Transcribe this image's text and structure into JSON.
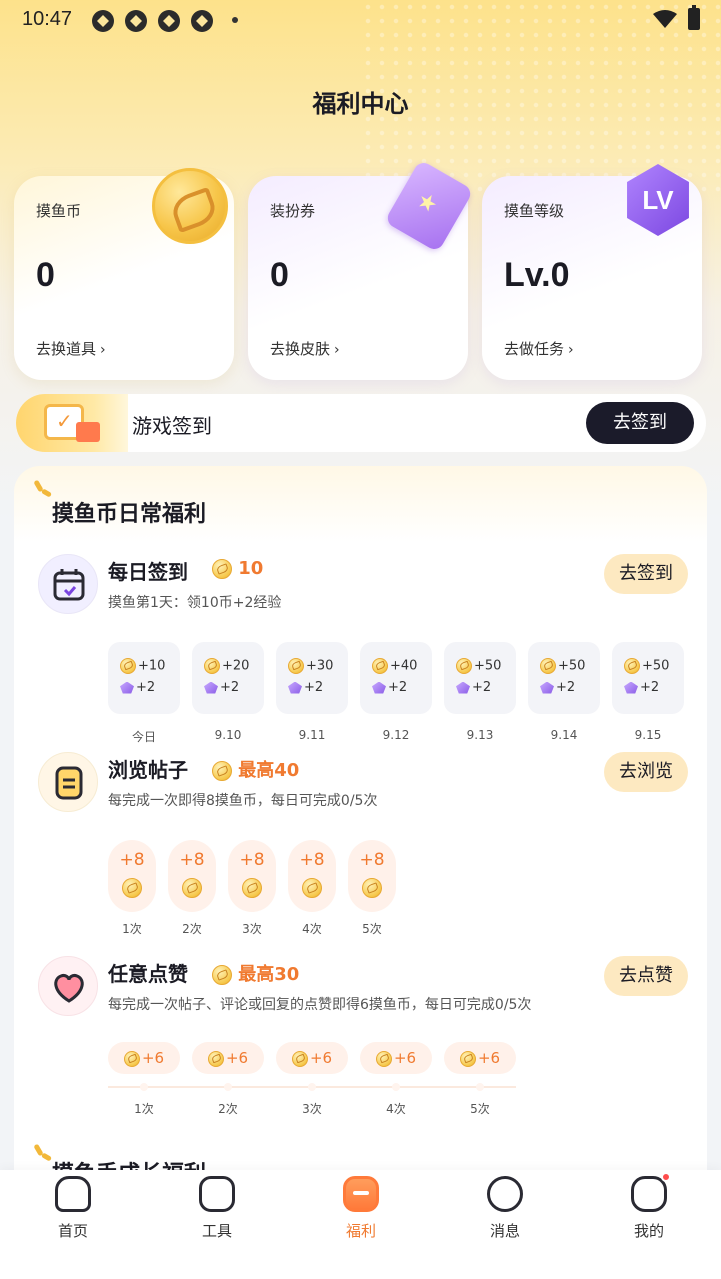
{
  "status_bar": {
    "time": "10:47"
  },
  "header": {
    "title": "福利中心"
  },
  "stats": [
    {
      "label": "摸鱼币",
      "value": "0",
      "link": "去换道具"
    },
    {
      "label": "装扮券",
      "value": "0",
      "link": "去换皮肤"
    },
    {
      "label": "摸鱼等级",
      "value": "Lv.0",
      "link": "去做任务",
      "badge": "LV"
    }
  ],
  "game_signin": {
    "label": "游戏签到",
    "button": "去签到"
  },
  "daily": {
    "title": "摸鱼币日常福利",
    "tasks": {
      "checkin": {
        "title": "每日签到",
        "reward": "10",
        "desc": "摸鱼第1天：领10币+2经验",
        "button": "去签到",
        "days": [
          {
            "coins": "+10",
            "exp": "+2",
            "label": "今日"
          },
          {
            "coins": "+20",
            "exp": "+2",
            "label": "9.10"
          },
          {
            "coins": "+30",
            "exp": "+2",
            "label": "9.11"
          },
          {
            "coins": "+40",
            "exp": "+2",
            "label": "9.12"
          },
          {
            "coins": "+50",
            "exp": "+2",
            "label": "9.13"
          },
          {
            "coins": "+50",
            "exp": "+2",
            "label": "9.14"
          },
          {
            "coins": "+50",
            "exp": "+2",
            "label": "9.15"
          }
        ]
      },
      "browse": {
        "title": "浏览帖子",
        "reward": "最高40",
        "desc": "每完成一次即得8摸鱼币，每日可完成0/5次",
        "button": "去浏览",
        "steps": [
          {
            "value": "+8",
            "label": "1次"
          },
          {
            "value": "+8",
            "label": "2次"
          },
          {
            "value": "+8",
            "label": "3次"
          },
          {
            "value": "+8",
            "label": "4次"
          },
          {
            "value": "+8",
            "label": "5次"
          }
        ]
      },
      "like": {
        "title": "任意点赞",
        "reward": "最高30",
        "desc": "每完成一次帖子、评论或回复的点赞即得6摸鱼币，每日可完成0/5次",
        "button": "去点赞",
        "steps": [
          {
            "value": "+6",
            "label": "1次"
          },
          {
            "value": "+6",
            "label": "2次"
          },
          {
            "value": "+6",
            "label": "3次"
          },
          {
            "value": "+6",
            "label": "4次"
          },
          {
            "value": "+6",
            "label": "5次"
          }
        ]
      }
    }
  },
  "growth": {
    "title": "摸鱼手成长福利"
  },
  "tabbar": [
    {
      "label": "首页",
      "icon": "home-icon"
    },
    {
      "label": "工具",
      "icon": "tool-icon"
    },
    {
      "label": "福利",
      "icon": "gift-icon",
      "active": true
    },
    {
      "label": "消息",
      "icon": "message-icon"
    },
    {
      "label": "我的",
      "icon": "profile-icon",
      "badge": true
    }
  ],
  "colors": {
    "accent": "#f07a30",
    "dark_button": "#1b1b2a",
    "pill_button": "#fde9c1"
  }
}
